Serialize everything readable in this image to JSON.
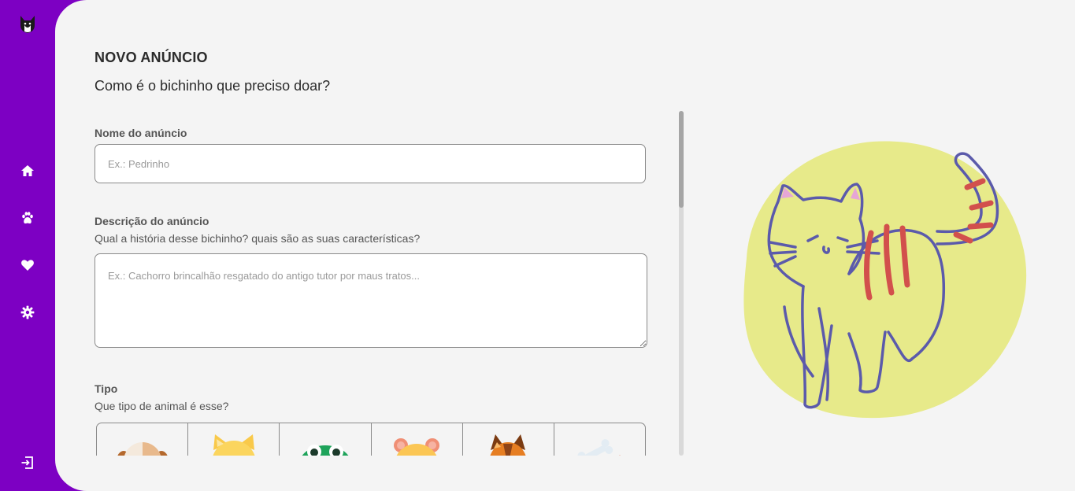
{
  "page": {
    "title": "NOVO ANÚNCIO",
    "subtitle": "Como é o bichinho que preciso doar?"
  },
  "sidebar": {
    "items": [
      {
        "icon": "home-icon"
      },
      {
        "icon": "paw-icon"
      },
      {
        "icon": "heart-icon"
      },
      {
        "icon": "gear-icon"
      }
    ],
    "logout_icon": "logout-icon"
  },
  "form": {
    "name": {
      "label": "Nome do anúncio",
      "placeholder": "Ex.: Pedrinho",
      "value": ""
    },
    "description": {
      "label": "Descrição do anúncio",
      "hint": "Qual a história desse bichinho? quais são as suas características?",
      "placeholder": "Ex.: Cachorro brincalhão resgatado do antigo tutor por maus tratos...",
      "value": ""
    },
    "type": {
      "label": "Tipo",
      "hint": "Que tipo de animal é esse?",
      "options": [
        {
          "icon": "dog-icon"
        },
        {
          "icon": "cat-icon"
        },
        {
          "icon": "reptile-icon"
        },
        {
          "icon": "rodent-icon"
        },
        {
          "icon": "horse-icon"
        },
        {
          "icon": "other-icon"
        }
      ]
    }
  },
  "colors": {
    "brand": "#7d00c3",
    "background": "#f4f4f4",
    "blob": "#e7ea8a",
    "cat_stroke": "#5b5aab",
    "cat_stripes": "#d2504c"
  }
}
